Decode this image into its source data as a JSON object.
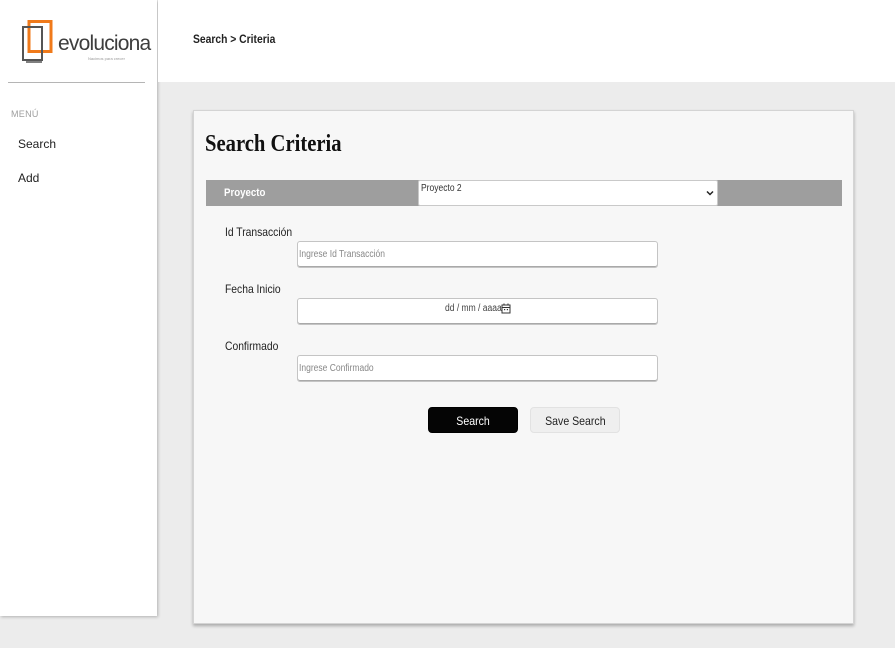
{
  "brand": {
    "name": "evoluciona",
    "tagline": "Nacimos para crecer",
    "accent_color": "#f07a1a"
  },
  "sidebar": {
    "menu_label": "MENÚ",
    "items": [
      {
        "label": "Search"
      },
      {
        "label": "Add"
      }
    ]
  },
  "header": {
    "breadcrumb": "Search > Criteria"
  },
  "main": {
    "title": "Search Criteria",
    "project": {
      "label": "Proyecto",
      "selected": "Proyecto 2"
    },
    "fields": [
      {
        "label": "Id Transacción",
        "placeholder": "Ingrese Id Transacción"
      },
      {
        "label": "Fecha Inicio",
        "value": "dd / mm / aaaa"
      },
      {
        "label": "Confirmado",
        "placeholder": "Ingrese Confirmado"
      }
    ],
    "buttons": {
      "search": "Search",
      "save_search": "Save Search"
    }
  },
  "icons": {
    "select_arrow": "chevron-down-icon",
    "date_picker": "calendar-icon"
  }
}
